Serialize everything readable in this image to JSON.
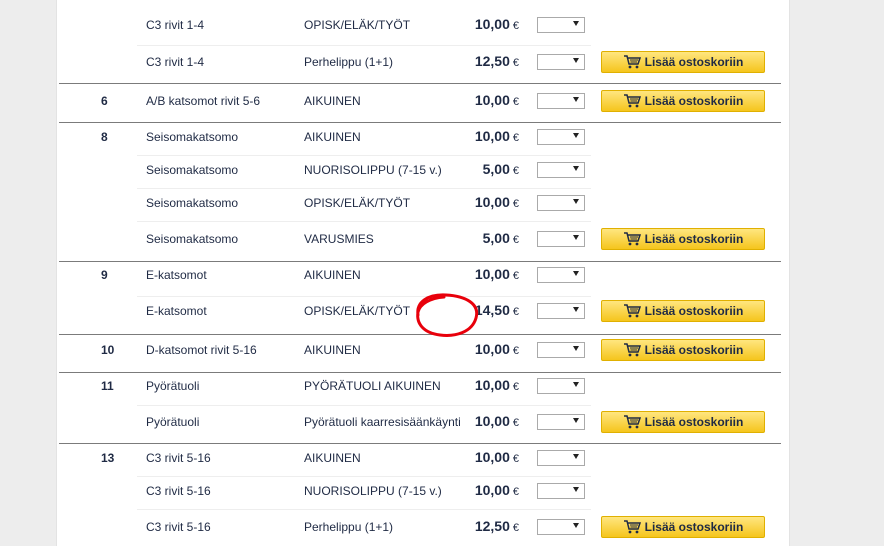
{
  "currency": "€",
  "add_to_cart_label": "Lisää ostoskoriin",
  "rows": [
    {
      "num": "",
      "section": "C3 rivit 1-4",
      "type": "OPISK/ELÄK/TYÖT",
      "price": "10,00",
      "cart": false
    },
    {
      "num": "",
      "section": "C3 rivit 1-4",
      "type": "Perhelippu (1+1)",
      "price": "12,50",
      "cart": true
    },
    {
      "num": "6",
      "section": "A/B katsomot rivit 5-6",
      "type": "AIKUINEN",
      "price": "10,00",
      "cart": true
    },
    {
      "num": "8",
      "section": "Seisomakatsomo",
      "type": "AIKUINEN",
      "price": "10,00",
      "cart": false
    },
    {
      "num": "",
      "section": "Seisomakatsomo",
      "type": "NUORISOLIPPU (7-15 v.)",
      "price": "5,00",
      "cart": false
    },
    {
      "num": "",
      "section": "Seisomakatsomo",
      "type": "OPISK/ELÄK/TYÖT",
      "price": "10,00",
      "cart": false
    },
    {
      "num": "",
      "section": "Seisomakatsomo",
      "type": "VARUSMIES",
      "price": "5,00",
      "cart": true
    },
    {
      "num": "9",
      "section": "E-katsomot",
      "type": "AIKUINEN",
      "price": "10,00",
      "cart": false
    },
    {
      "num": "",
      "section": "E-katsomot",
      "type": "OPISK/ELÄK/TYÖT",
      "price": "14,50",
      "cart": true
    },
    {
      "num": "10",
      "section": "D-katsomot rivit 5-16",
      "type": "AIKUINEN",
      "price": "10,00",
      "cart": true
    },
    {
      "num": "11",
      "section": "Pyörätuoli",
      "type": "PYÖRÄTUOLI AIKUINEN",
      "price": "10,00",
      "cart": false
    },
    {
      "num": "",
      "section": "Pyörätuoli",
      "type": "Pyörätuoli kaarresisäänkäynti",
      "price": "10,00",
      "cart": true
    },
    {
      "num": "13",
      "section": "C3 rivit 5-16",
      "type": "AIKUINEN",
      "price": "10,00",
      "cart": false
    },
    {
      "num": "",
      "section": "C3 rivit 5-16",
      "type": "NUORISOLIPPU (7-15 v.)",
      "price": "10,00",
      "cart": false
    },
    {
      "num": "",
      "section": "C3 rivit 5-16",
      "type": "Perhelippu (1+1)",
      "price": "12,50",
      "cart": true
    }
  ],
  "colors": {
    "button": "#f7cc33",
    "annotation": "#e8000b",
    "text": "#1f2a44"
  },
  "icons": {
    "cart": "cart-icon",
    "dropdown": "chevron-down-icon"
  }
}
